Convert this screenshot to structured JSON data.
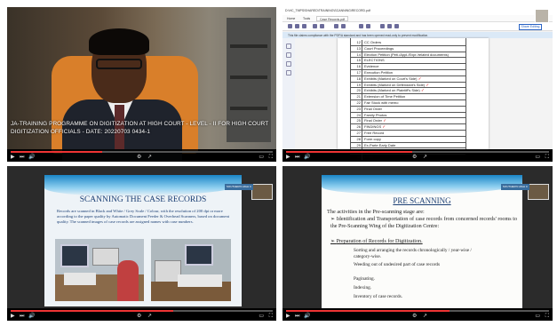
{
  "p1": {
    "caption": "JA-TRAINING PROGRAMME ON DIGITIZATION AT HIGH COURT - LEVEL - II FOR HIGH COURT DIGITIZATION OFFICIALS - DATE: 20220703 0434-1",
    "progress": 0.35
  },
  "p2": {
    "title": "D:\\HC_TMPS\\SHARED\\TRAINING\\SCANNING\\RECORD.pdf",
    "tabs": [
      "Home",
      "Tools",
      "Case Records.pdf"
    ],
    "share": "Share Editing",
    "info": "This file claims compliance with the PDF/A standard and has been opened read-only to prevent modification.",
    "rows": [
      {
        "n": "12",
        "t": "CC Orders"
      },
      {
        "n": "13",
        "t": "Court Proceedings"
      },
      {
        "n": "14",
        "t": "Election Petition (Peti./Appl./Expr./related documents)"
      },
      {
        "n": "15",
        "t": "ELECTIONS"
      },
      {
        "n": "16",
        "t": "Evidence"
      },
      {
        "n": "17",
        "t": "Execution Petition"
      },
      {
        "n": "18",
        "t": "Exhibits (Marked on Court's Side)"
      },
      {
        "n": "19",
        "t": "Exhibits (Marked on Defendant's Side)"
      },
      {
        "n": "20",
        "t": "Exhibits (Marked on Plaintiff's Side)"
      },
      {
        "n": "21",
        "t": "Extension of Time Petition"
      },
      {
        "n": "22",
        "t": "Fair Stock with memo"
      },
      {
        "n": "23",
        "t": "Final Order"
      },
      {
        "n": "24",
        "t": "Family Photos"
      },
      {
        "n": "25",
        "t": "Final Order"
      },
      {
        "n": "26",
        "t": "FINDINGS"
      },
      {
        "n": "27",
        "t": "Free Record"
      },
      {
        "n": "28",
        "t": "Form copy"
      },
      {
        "n": "29",
        "t": "Ex-Parte Early Date"
      },
      {
        "n": "30",
        "t": "Home Papers (Records)"
      },
      {
        "n": "31",
        "t": "Index"
      }
    ],
    "progress": 0.48
  },
  "p3": {
    "title": "SCANNING THE CASE RECORDS",
    "bullet": "Records are scanned in Black and White / Grey Scale / Colour, with the resolution of 200 dpi or more according to the paper quality by Automatic Document Feeder & Overhead Scanners, based on document quality. The scanned images of case records are assigned names with case numbers.",
    "pip_name": "SOUTHERN HIGH C",
    "progress": 0.62
  },
  "p4": {
    "title": "PRE SCANNING",
    "intro": "The activities in the Pre-scanning stage are:",
    "b1": "Identification and Transportation of case records from concerned records' rooms to the Pre-Scanning Wing of the Digitization Centre:",
    "b2": "Preparation of Records for Digitization.",
    "items": [
      "Sorting and arranging the records chronologically / year-wise / category-wise.",
      "Weeding out of undesired part of case records",
      "Paginating.",
      "Indexing.",
      "Inventory of case records."
    ],
    "pip_name": "SOUTHERN HIGH C",
    "progress": 0.62
  }
}
